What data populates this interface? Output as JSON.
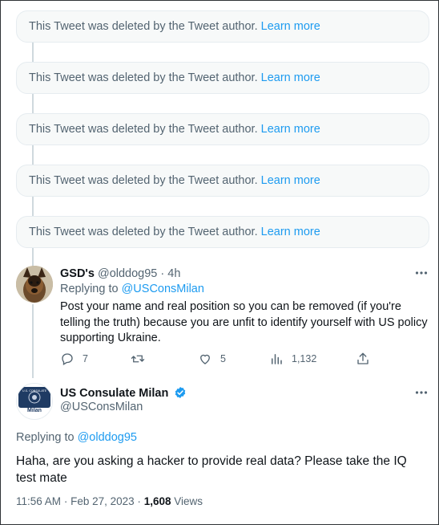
{
  "deleted_notice": {
    "message": "This Tweet was deleted by the Tweet author.",
    "link": "Learn more",
    "count": 5
  },
  "reply_tweet": {
    "display_name": "GSD's",
    "handle": "@olddog95",
    "separator": "·",
    "time": "4h",
    "replying_prefix": "Replying to",
    "replying_handle": "@USConsMilan",
    "text": "Post your name and real position so you can be removed (if you're telling the truth) because you are unfit to identify yourself with US policy supporting Ukraine.",
    "more_icon": "more-horizontal-icon",
    "actions": {
      "reply_count": "7",
      "retweet_count": "",
      "like_count": "5",
      "views_count": "1,132"
    }
  },
  "main_tweet": {
    "display_name": "US Consulate Milan",
    "handle": "@USConsMilan",
    "avatar_caption": "Milan",
    "avatar_seal_text": "U.S. CONSULATE",
    "verified_color": "#1d9bf0",
    "replying_prefix": "Replying to",
    "replying_handle": "@olddog95",
    "text": "Haha, are you asking a hacker to provide real data? Please take the IQ test mate",
    "time": "11:56 AM",
    "date": "Feb 27, 2023",
    "separator": "·",
    "views_count": "1,608",
    "views_label": "Views"
  },
  "colors": {
    "link": "#1d9bf0",
    "muted": "#536471",
    "text": "#0f1419",
    "deleted_bg": "#f7f9f9",
    "thread_line": "#cfd9de"
  }
}
